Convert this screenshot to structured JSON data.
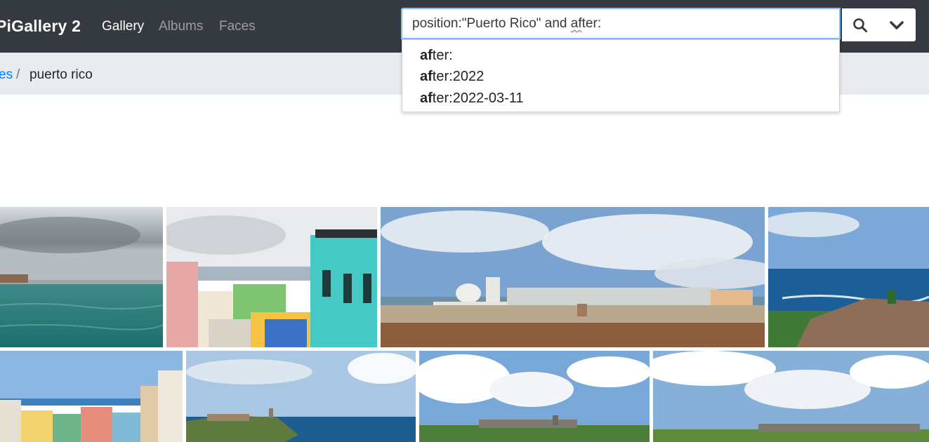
{
  "app": {
    "brand": "PiGallery 2"
  },
  "nav": {
    "items": [
      {
        "label": "Gallery",
        "active": true
      },
      {
        "label": "Albums",
        "active": false
      },
      {
        "label": "Faces",
        "active": false
      }
    ]
  },
  "search": {
    "value_prefix": "position:\"Puerto Rico\" and ",
    "value_misspelled": "af",
    "value_suffix": "ter:",
    "search_icon": "search-icon",
    "dropdown_icon": "chevron-down-icon"
  },
  "autocomplete": {
    "match": "af",
    "items": [
      {
        "bold": "af",
        "rest": "ter:"
      },
      {
        "bold": "af",
        "rest": "ter:2022"
      },
      {
        "bold": "af",
        "rest": "ter:2022-03-11"
      }
    ]
  },
  "breadcrumb": {
    "parent_label": "es",
    "separator": "/",
    "current": "puerto rico"
  },
  "photos": [
    {
      "name": "stormy-harbor"
    },
    {
      "name": "colorful-rooftops"
    },
    {
      "name": "city-skyline-panorama"
    },
    {
      "name": "coastal-fort-ocean"
    },
    {
      "name": "old-san-juan-houses"
    },
    {
      "name": "fort-on-headland"
    },
    {
      "name": "fort-field-clouds"
    },
    {
      "name": "fortress-lawn"
    }
  ],
  "colors": {
    "navbar": "#343a40",
    "breadcrumb_bg": "#e9ecef",
    "link": "#007bff",
    "focus_border": "#80bdff"
  }
}
